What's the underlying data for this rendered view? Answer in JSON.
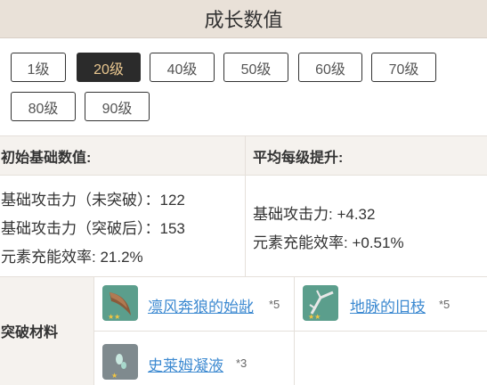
{
  "header": {
    "title": "成长数值"
  },
  "levels": [
    "1级",
    "20级",
    "40级",
    "50级",
    "60级",
    "70级",
    "80级",
    "90级"
  ],
  "active_level": "20级",
  "table": {
    "initial_header": "初始基础数值:",
    "per_level_header": "平均每级提升:",
    "initial_stats": [
      "基础攻击力（未突破）：122",
      "基础攻击力（突破后）：153",
      "元素充能效率: 21.2%"
    ],
    "per_level_stats": [
      "基础攻击力: +4.32",
      "元素充能效率: +0.51%"
    ],
    "materials_label": "突破材料",
    "materials": [
      {
        "name": "凛风奔狼的始龀",
        "count": "*5",
        "icon": "wolf-tooth-icon",
        "bg": "#5b9e8c"
      },
      {
        "name": "地脉的旧枝",
        "count": "*5",
        "icon": "ley-line-branch-icon",
        "bg": "#5b9e8c"
      },
      {
        "name": "史莱姆凝液",
        "count": "*3",
        "icon": "slime-condensate-icon",
        "bg": "#7f8a8e"
      }
    ]
  },
  "colors": {
    "header_bg": "#e9e1d8",
    "active_btn_bg": "#2b2b2b",
    "active_btn_text": "#e8c68f",
    "link": "#3d8ad1",
    "label_bg": "#f5f2ee"
  }
}
